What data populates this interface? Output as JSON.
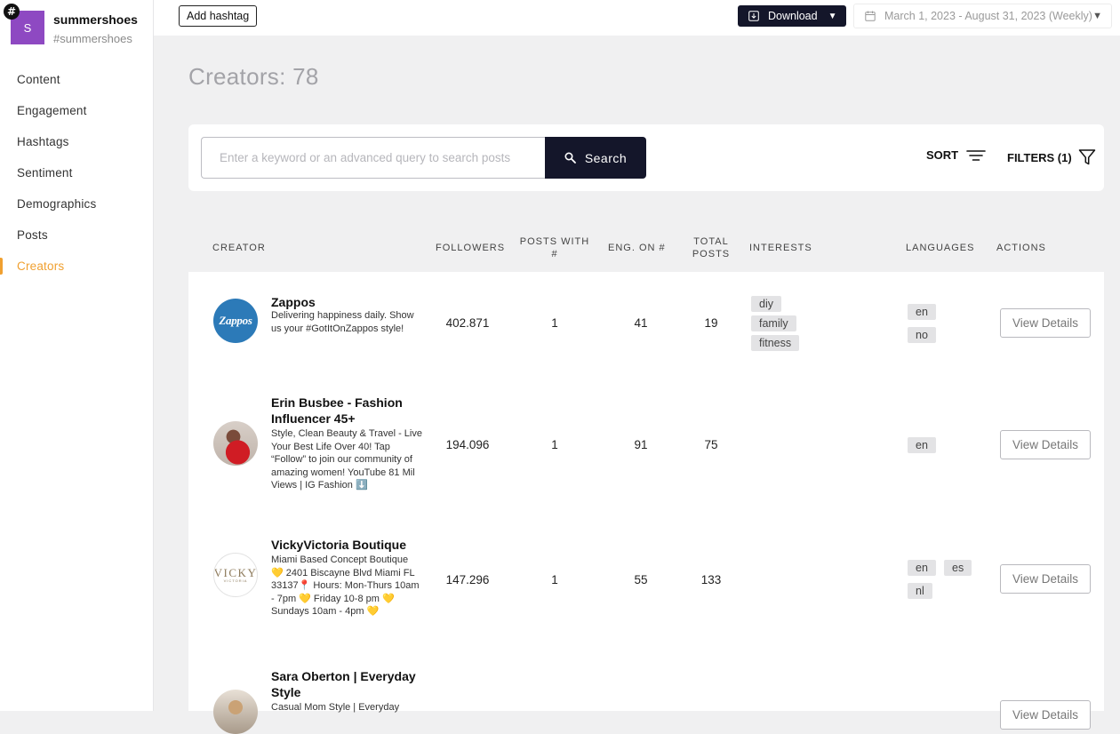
{
  "sidebar": {
    "brand": {
      "avatar_letter": "S",
      "name": "summershoes",
      "tag": "#summershoes"
    },
    "items": [
      {
        "label": "Content"
      },
      {
        "label": "Engagement"
      },
      {
        "label": "Hashtags"
      },
      {
        "label": "Sentiment"
      },
      {
        "label": "Demographics"
      },
      {
        "label": "Posts"
      },
      {
        "label": "Creators",
        "active": true
      }
    ]
  },
  "topbar": {
    "add_hashtag": "Add hashtag",
    "download": "Download",
    "date_range": "March 1, 2023 - August 31, 2023 (Weekly)"
  },
  "page_title": "Creators: 78",
  "search": {
    "placeholder": "Enter a keyword or an advanced query to search posts",
    "button": "Search",
    "sort": "SORT",
    "filters": "FILTERS (1)"
  },
  "table": {
    "headers": {
      "creator": "CREATOR",
      "followers": "FOLLOWERS",
      "posts_with_1": "POSTS WITH",
      "posts_with_2": "#",
      "eng_on": "ENG. ON #",
      "total_posts_1": "TOTAL",
      "total_posts_2": "POSTS",
      "interests": "INTERESTS",
      "languages": "LANGUAGES",
      "actions": "ACTIONS"
    },
    "view_details": "View Details",
    "rows": [
      {
        "name": "Zappos",
        "avatar_text": "Zappos",
        "bio": "Delivering happiness daily. Show us your #GotItOnZappos style!",
        "followers": "402.871",
        "posts_with": "1",
        "eng_on": "41",
        "total_posts": "19",
        "interests": [
          "diy",
          "family",
          "fitness"
        ],
        "languages": [
          "en",
          "no"
        ]
      },
      {
        "name": "Erin Busbee - Fashion Influencer 45+",
        "bio": "Style, Clean Beauty & Travel - Live Your Best Life Over 40! Tap “Follow” to join our community of amazing women! YouTube 81 Mil Views | IG Fashion ⬇️",
        "followers": "194.096",
        "posts_with": "1",
        "eng_on": "91",
        "total_posts": "75",
        "interests": [],
        "languages": [
          "en"
        ]
      },
      {
        "name": "VickyVictoria Boutique",
        "avatar_text": "VICKY",
        "avatar_sub": "VICTORIA",
        "bio": "Miami Based Concept Boutique 💛 2401 Biscayne Blvd Miami FL 33137📍 Hours: Mon-Thurs 10am - 7pm 💛 Friday 10-8 pm 💛 Sundays 10am - 4pm 💛",
        "followers": "147.296",
        "posts_with": "1",
        "eng_on": "55",
        "total_posts": "133",
        "interests": [],
        "languages": [
          "en",
          "es",
          "nl"
        ]
      },
      {
        "name": "Sara Oberton | Everyday Style",
        "bio": "Casual Mom Style | Everyday",
        "followers": "",
        "posts_with": "",
        "eng_on": "",
        "total_posts": "",
        "interests": [],
        "languages": []
      }
    ]
  },
  "colors": {
    "accent": "#f0a030",
    "dark": "#14162a",
    "brand_avatar": "#8e49c2",
    "zappos": "#2c7ab8"
  },
  "icons": {
    "brand": "hashtag-icon",
    "download": "download-icon",
    "calendar": "calendar-icon",
    "search": "search-icon",
    "sort": "sort-icon",
    "filter": "filter-icon"
  }
}
